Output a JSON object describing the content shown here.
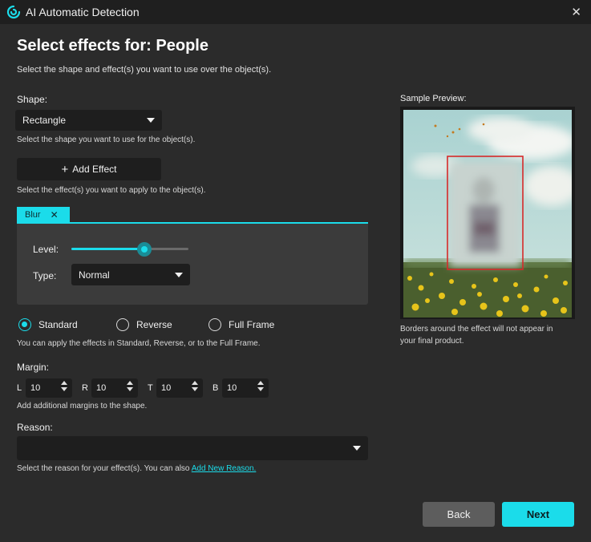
{
  "window": {
    "title": "AI Automatic Detection"
  },
  "heading": "Select effects for: People",
  "subheading": "Select the shape and effect(s) you want to use over the object(s).",
  "shape": {
    "label": "Shape:",
    "value": "Rectangle",
    "hint": "Select the shape you want to use for the object(s)."
  },
  "add_effect": {
    "label": "Add Effect",
    "hint": "Select the effect(s) you want to apply to the object(s)."
  },
  "effect_tab": {
    "name": "Blur",
    "level_label": "Level:",
    "level_value": 0.62,
    "type_label": "Type:",
    "type_value": "Normal"
  },
  "apply_mode": {
    "options": [
      "Standard",
      "Reverse",
      "Full Frame"
    ],
    "selected": "Standard",
    "hint": "You can apply the effects in Standard, Reverse, or to the Full Frame."
  },
  "margin": {
    "label": "Margin:",
    "fields": [
      {
        "letter": "L",
        "value": "10"
      },
      {
        "letter": "R",
        "value": "10"
      },
      {
        "letter": "T",
        "value": "10"
      },
      {
        "letter": "B",
        "value": "10"
      }
    ],
    "hint": "Add additional margins to the shape."
  },
  "reason": {
    "label": "Reason:",
    "value": "",
    "hint_prefix": "Select the reason for your effect(s). You can also ",
    "link": "Add New Reason."
  },
  "preview": {
    "label": "Sample Preview:",
    "note_line1": "Borders around the effect will not appear in",
    "note_line2": "your final product."
  },
  "buttons": {
    "back": "Back",
    "next": "Next"
  },
  "colors": {
    "accent": "#1bdcea",
    "background": "#2b2b2b",
    "field": "#1e1e1e",
    "border_highlight": "#d62a2a"
  }
}
